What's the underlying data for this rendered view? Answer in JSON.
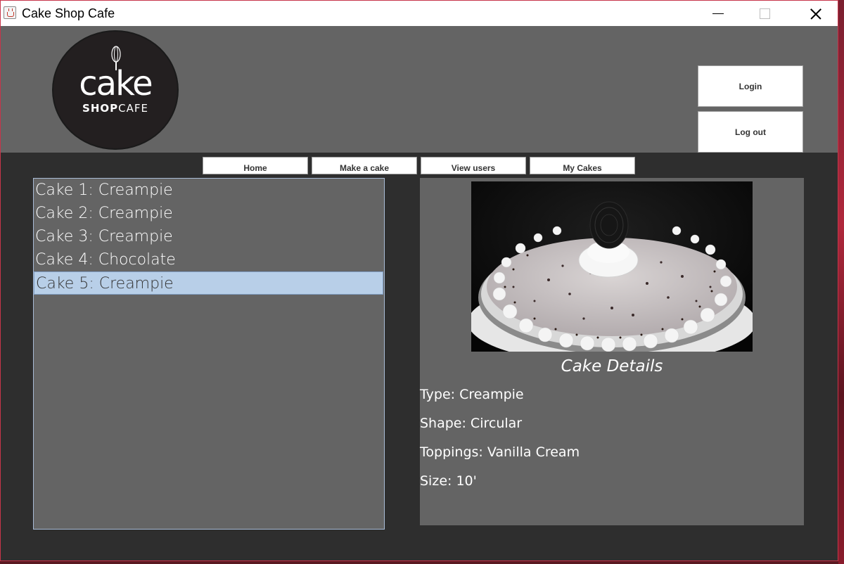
{
  "window": {
    "title": "Cake Shop Cafe"
  },
  "logo": {
    "main": "cake",
    "sub_bold": "SHOP",
    "sub_thin": "CAFE"
  },
  "header": {
    "login_label": "Login",
    "logout_label": "Log out"
  },
  "nav": {
    "home": "Home",
    "make_cake": "Make a cake",
    "view_users": "View users",
    "my_cakes": "My Cakes"
  },
  "cakes": [
    {
      "label": "Cake 1: Creampie"
    },
    {
      "label": "Cake 2: Creampie"
    },
    {
      "label": "Cake 3: Creampie"
    },
    {
      "label": "Cake 4: Chocolate"
    },
    {
      "label": "Cake 5: Creampie"
    }
  ],
  "selected_index": 4,
  "details": {
    "title": "Cake Details",
    "type": "Type: Creampie",
    "shape": "Shape: Circular",
    "toppings": "Toppings: Vanilla Cream",
    "size": "Size: 10'"
  },
  "colors": {
    "header_bg": "#646464",
    "body_bg": "#2e2e2e",
    "selection": "#b8cfe8"
  }
}
